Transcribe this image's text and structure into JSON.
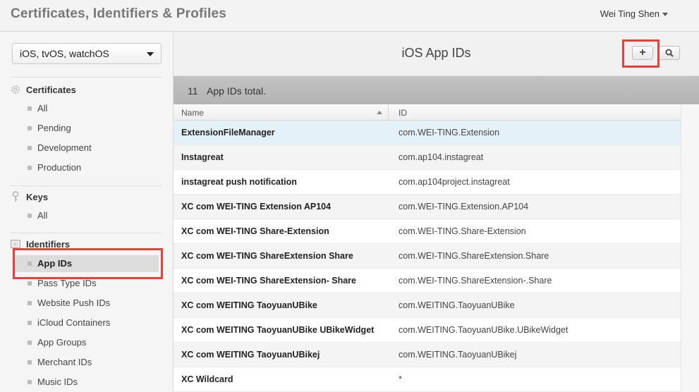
{
  "header": {
    "app_title": "Certificates, Identifiers & Profiles",
    "user_name": "Wei Ting Shen"
  },
  "sidebar": {
    "platform": "iOS, tvOS, watchOS",
    "sections": [
      {
        "title": "Certificates",
        "icon": "certificate-icon",
        "items": [
          "All",
          "Pending",
          "Development",
          "Production"
        ]
      },
      {
        "title": "Keys",
        "icon": "key-icon",
        "items": [
          "All"
        ]
      },
      {
        "title": "Identifiers",
        "icon": "id-icon",
        "items": [
          "App IDs",
          "Pass Type IDs",
          "Website Push IDs",
          "iCloud Containers",
          "App Groups",
          "Merchant IDs",
          "Music IDs"
        ]
      }
    ],
    "active_item": "App IDs"
  },
  "main": {
    "title": "iOS App IDs",
    "add_label": "+",
    "count": "11",
    "count_text": "App IDs total.",
    "columns": [
      "Name",
      "ID"
    ],
    "rows": [
      {
        "name": "ExtensionFileManager",
        "id": "com.WEI-TING.Extension"
      },
      {
        "name": "Instagreat",
        "id": "com.ap104.instagreat"
      },
      {
        "name": "instagreat push notification",
        "id": "com.ap104project.instagreat"
      },
      {
        "name": "XC com WEI-TING Extension AP104",
        "id": "com.WEI-TING.Extension.AP104"
      },
      {
        "name": "XC com WEI-TING Share-Extension",
        "id": "com.WEI-TING.Share-Extension"
      },
      {
        "name": "XC com WEI-TING ShareExtension Share",
        "id": "com.WEI-TING.ShareExtension.Share"
      },
      {
        "name": "XC com WEI-TING ShareExtension- Share",
        "id": "com.WEI-TING.ShareExtension-.Share"
      },
      {
        "name": "XC com WEITING TaoyuanUBike",
        "id": "com.WEITING.TaoyuanUBike"
      },
      {
        "name": "XC com WEITING TaoyuanUBike UBikeWidget",
        "id": "com.WEITING.TaoyuanUBike.UBikeWidget"
      },
      {
        "name": "XC com WEITING TaoyuanUBikej",
        "id": "com.WEITING.TaoyuanUBikej"
      },
      {
        "name": "XC Wildcard",
        "id": "*"
      }
    ],
    "selected_row": "ExtensionFileManager"
  },
  "colors": {
    "highlight": "#e8403a",
    "selected_row": "#e4f1f8"
  }
}
